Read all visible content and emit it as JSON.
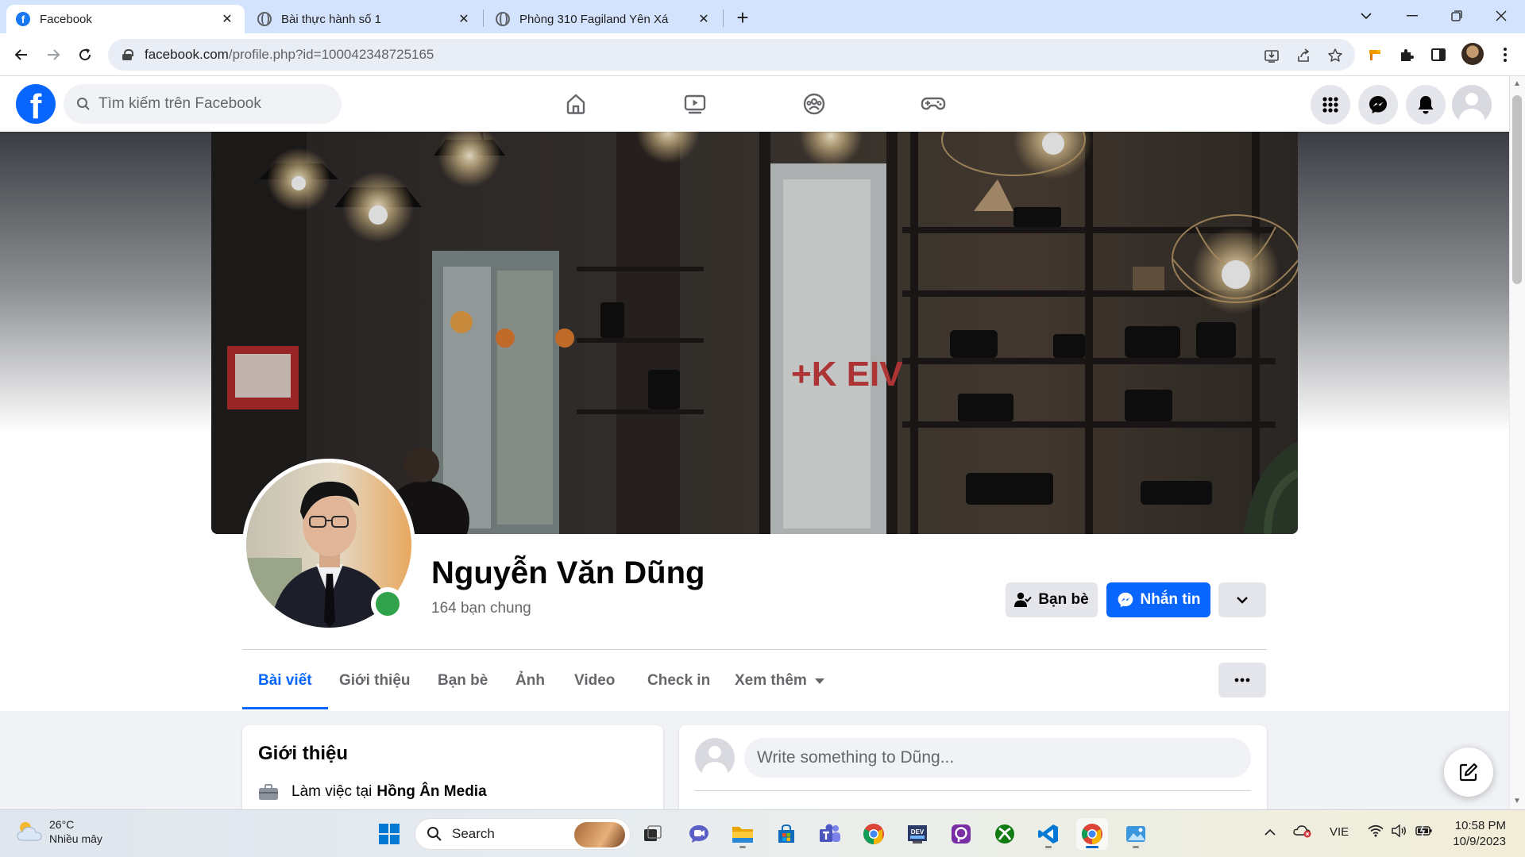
{
  "browser": {
    "tabs": [
      {
        "title": "Facebook",
        "active": true,
        "favicon": "facebook-icon"
      },
      {
        "title": "Bài thực hành số 1",
        "active": false,
        "favicon": "globe-icon"
      },
      {
        "title": "Phòng 310 Fagiland Yên Xá",
        "active": false,
        "favicon": "globe-icon"
      }
    ],
    "url_host": "facebook.com",
    "url_path": "/profile.php?id=100042348725165"
  },
  "facebook": {
    "search_placeholder": "Tìm kiếm trên Facebook",
    "profile": {
      "name": "Nguyễn Văn Dũng",
      "mutual_friends": "164 bạn chung",
      "friends_button": "Bạn bè",
      "message_button": "Nhắn tin"
    },
    "tabs": [
      "Bài viết",
      "Giới thiệu",
      "Bạn bè",
      "Ảnh",
      "Video",
      "Check in",
      "Xem thêm"
    ],
    "intro": {
      "title": "Giới thiệu",
      "work_prefix": "Làm việc tại",
      "work_place": "Hồng Ân Media"
    },
    "composer_placeholder": "Write something to Dũng..."
  },
  "taskbar": {
    "weather_temp": "26°C",
    "weather_desc": "Nhiều mây",
    "search_label": "Search",
    "language": "VIE",
    "time": "10:58 PM",
    "date": "10/9/2023"
  },
  "colors": {
    "fb_blue": "#0866ff",
    "online_green": "#31a24c",
    "chrome_tabbar": "#d3e3fd"
  }
}
